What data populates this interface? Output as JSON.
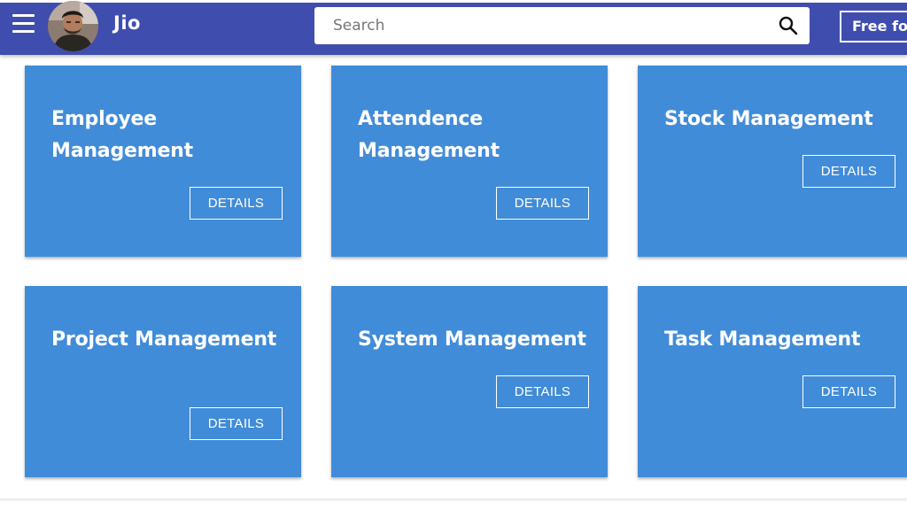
{
  "header": {
    "title": "Jio",
    "menu_icon": "hamburger-menu-icon",
    "avatar_icon": "user-avatar",
    "search": {
      "placeholder": "Search",
      "value": "",
      "icon": "search-icon"
    },
    "free_button_label": "Free for"
  },
  "cards": [
    {
      "title": "Employee Management",
      "button": "DETAILS"
    },
    {
      "title": "Attendence Management",
      "button": "DETAILS"
    },
    {
      "title": "Stock Management",
      "button": "DETAILS"
    },
    {
      "title": "Project Management",
      "button": "DETAILS"
    },
    {
      "title": "System Management",
      "button": "DETAILS"
    },
    {
      "title": "Task Management",
      "button": "DETAILS"
    }
  ],
  "colors": {
    "header_bg": "#3f4eae",
    "card_bg": "#418cd9",
    "text_on_color": "#ffffff"
  }
}
